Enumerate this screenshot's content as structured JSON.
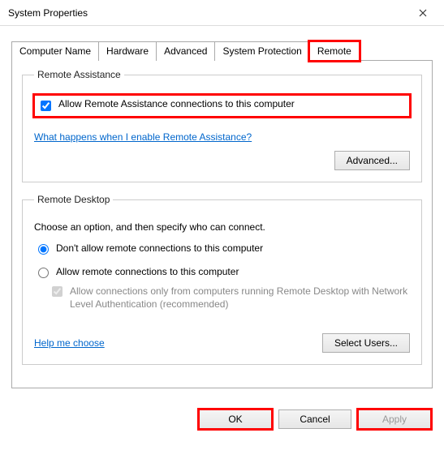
{
  "window": {
    "title": "System Properties"
  },
  "tabs": {
    "computer_name": "Computer Name",
    "hardware": "Hardware",
    "advanced": "Advanced",
    "system_protection": "System Protection",
    "remote": "Remote"
  },
  "remote_assistance": {
    "legend": "Remote Assistance",
    "checkbox_label": "Allow Remote Assistance connections to this computer",
    "checkbox_checked": true,
    "help_link": "What happens when I enable Remote Assistance?",
    "advanced_button": "Advanced..."
  },
  "remote_desktop": {
    "legend": "Remote Desktop",
    "instruction": "Choose an option, and then specify who can connect.",
    "option_disallow": "Don't allow remote connections to this computer",
    "option_allow": "Allow remote connections to this computer",
    "selected": "disallow",
    "nla_label": "Allow connections only from computers running Remote Desktop with Network Level Authentication (recommended)",
    "nla_checked": true,
    "help_link": "Help me choose",
    "select_users_button": "Select Users..."
  },
  "footer": {
    "ok": "OK",
    "cancel": "Cancel",
    "apply": "Apply"
  }
}
